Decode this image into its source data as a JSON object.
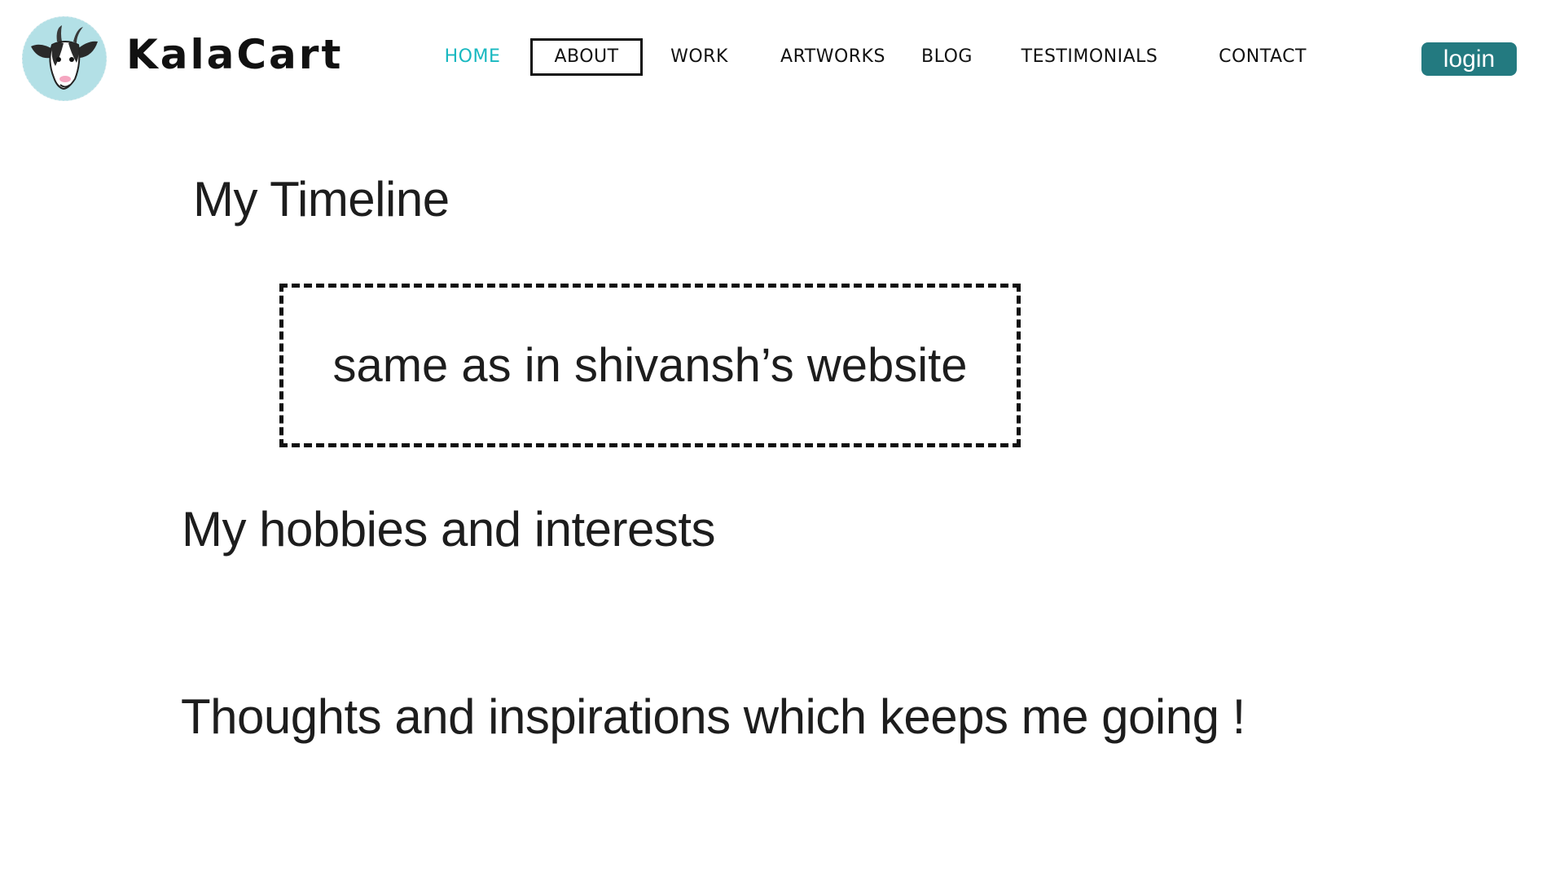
{
  "header": {
    "brand_name": "KalaCart",
    "logo_icon": "goat-face-icon",
    "nav": [
      {
        "label": "HOME",
        "state": "active"
      },
      {
        "label": "ABOUT",
        "state": "selected"
      },
      {
        "label": "WORK",
        "state": "default"
      },
      {
        "label": "ARTWORKS",
        "state": "default"
      },
      {
        "label": "BLOG",
        "state": "default"
      },
      {
        "label": "TESTIMONIALS",
        "state": "default"
      },
      {
        "label": "CONTACT",
        "state": "default"
      }
    ],
    "login_label": "login"
  },
  "main": {
    "timeline_heading": "My Timeline",
    "timeline_placeholder": "same as in shivansh’s website",
    "hobbies_heading": "My hobbies and interests",
    "thoughts_heading": "Thoughts and inspirations which keeps me going !"
  },
  "colors": {
    "active_nav": "#18b8c0",
    "login_bg": "#237a80",
    "logo_bg": "#b3e0e6"
  }
}
